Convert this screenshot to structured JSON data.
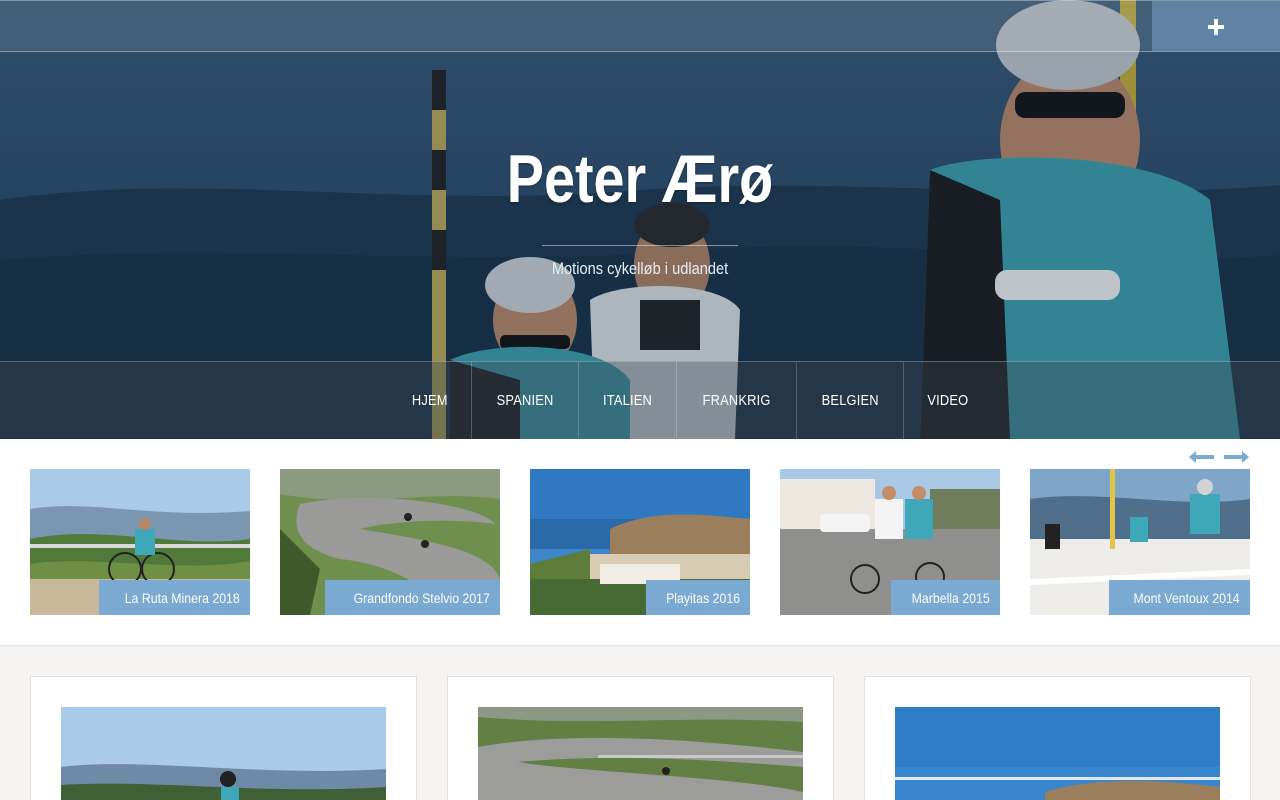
{
  "site": {
    "title": "Peter Ærø",
    "tagline": "Motions cykelløb i udlandet"
  },
  "topbar": {
    "menu_toggle_icon": "plus-icon"
  },
  "nav": {
    "items": [
      {
        "label": "HJEM"
      },
      {
        "label": "SPANIEN"
      },
      {
        "label": "ITALIEN"
      },
      {
        "label": "FRANKRIG"
      },
      {
        "label": "BELGIEN"
      },
      {
        "label": "VIDEO"
      }
    ]
  },
  "slider": {
    "prev_icon": "arrow-left-icon",
    "next_icon": "arrow-right-icon",
    "slides": [
      {
        "caption": "La Ruta Minera 2018"
      },
      {
        "caption": "Grandfondo Stelvio 2017"
      },
      {
        "caption": "Playitas 2016"
      },
      {
        "caption": "Marbella 2015"
      },
      {
        "caption": "Mont Ventoux 2014"
      }
    ]
  },
  "colors": {
    "accent": "#7aa9d1",
    "page_background": "#f6f4f3"
  }
}
